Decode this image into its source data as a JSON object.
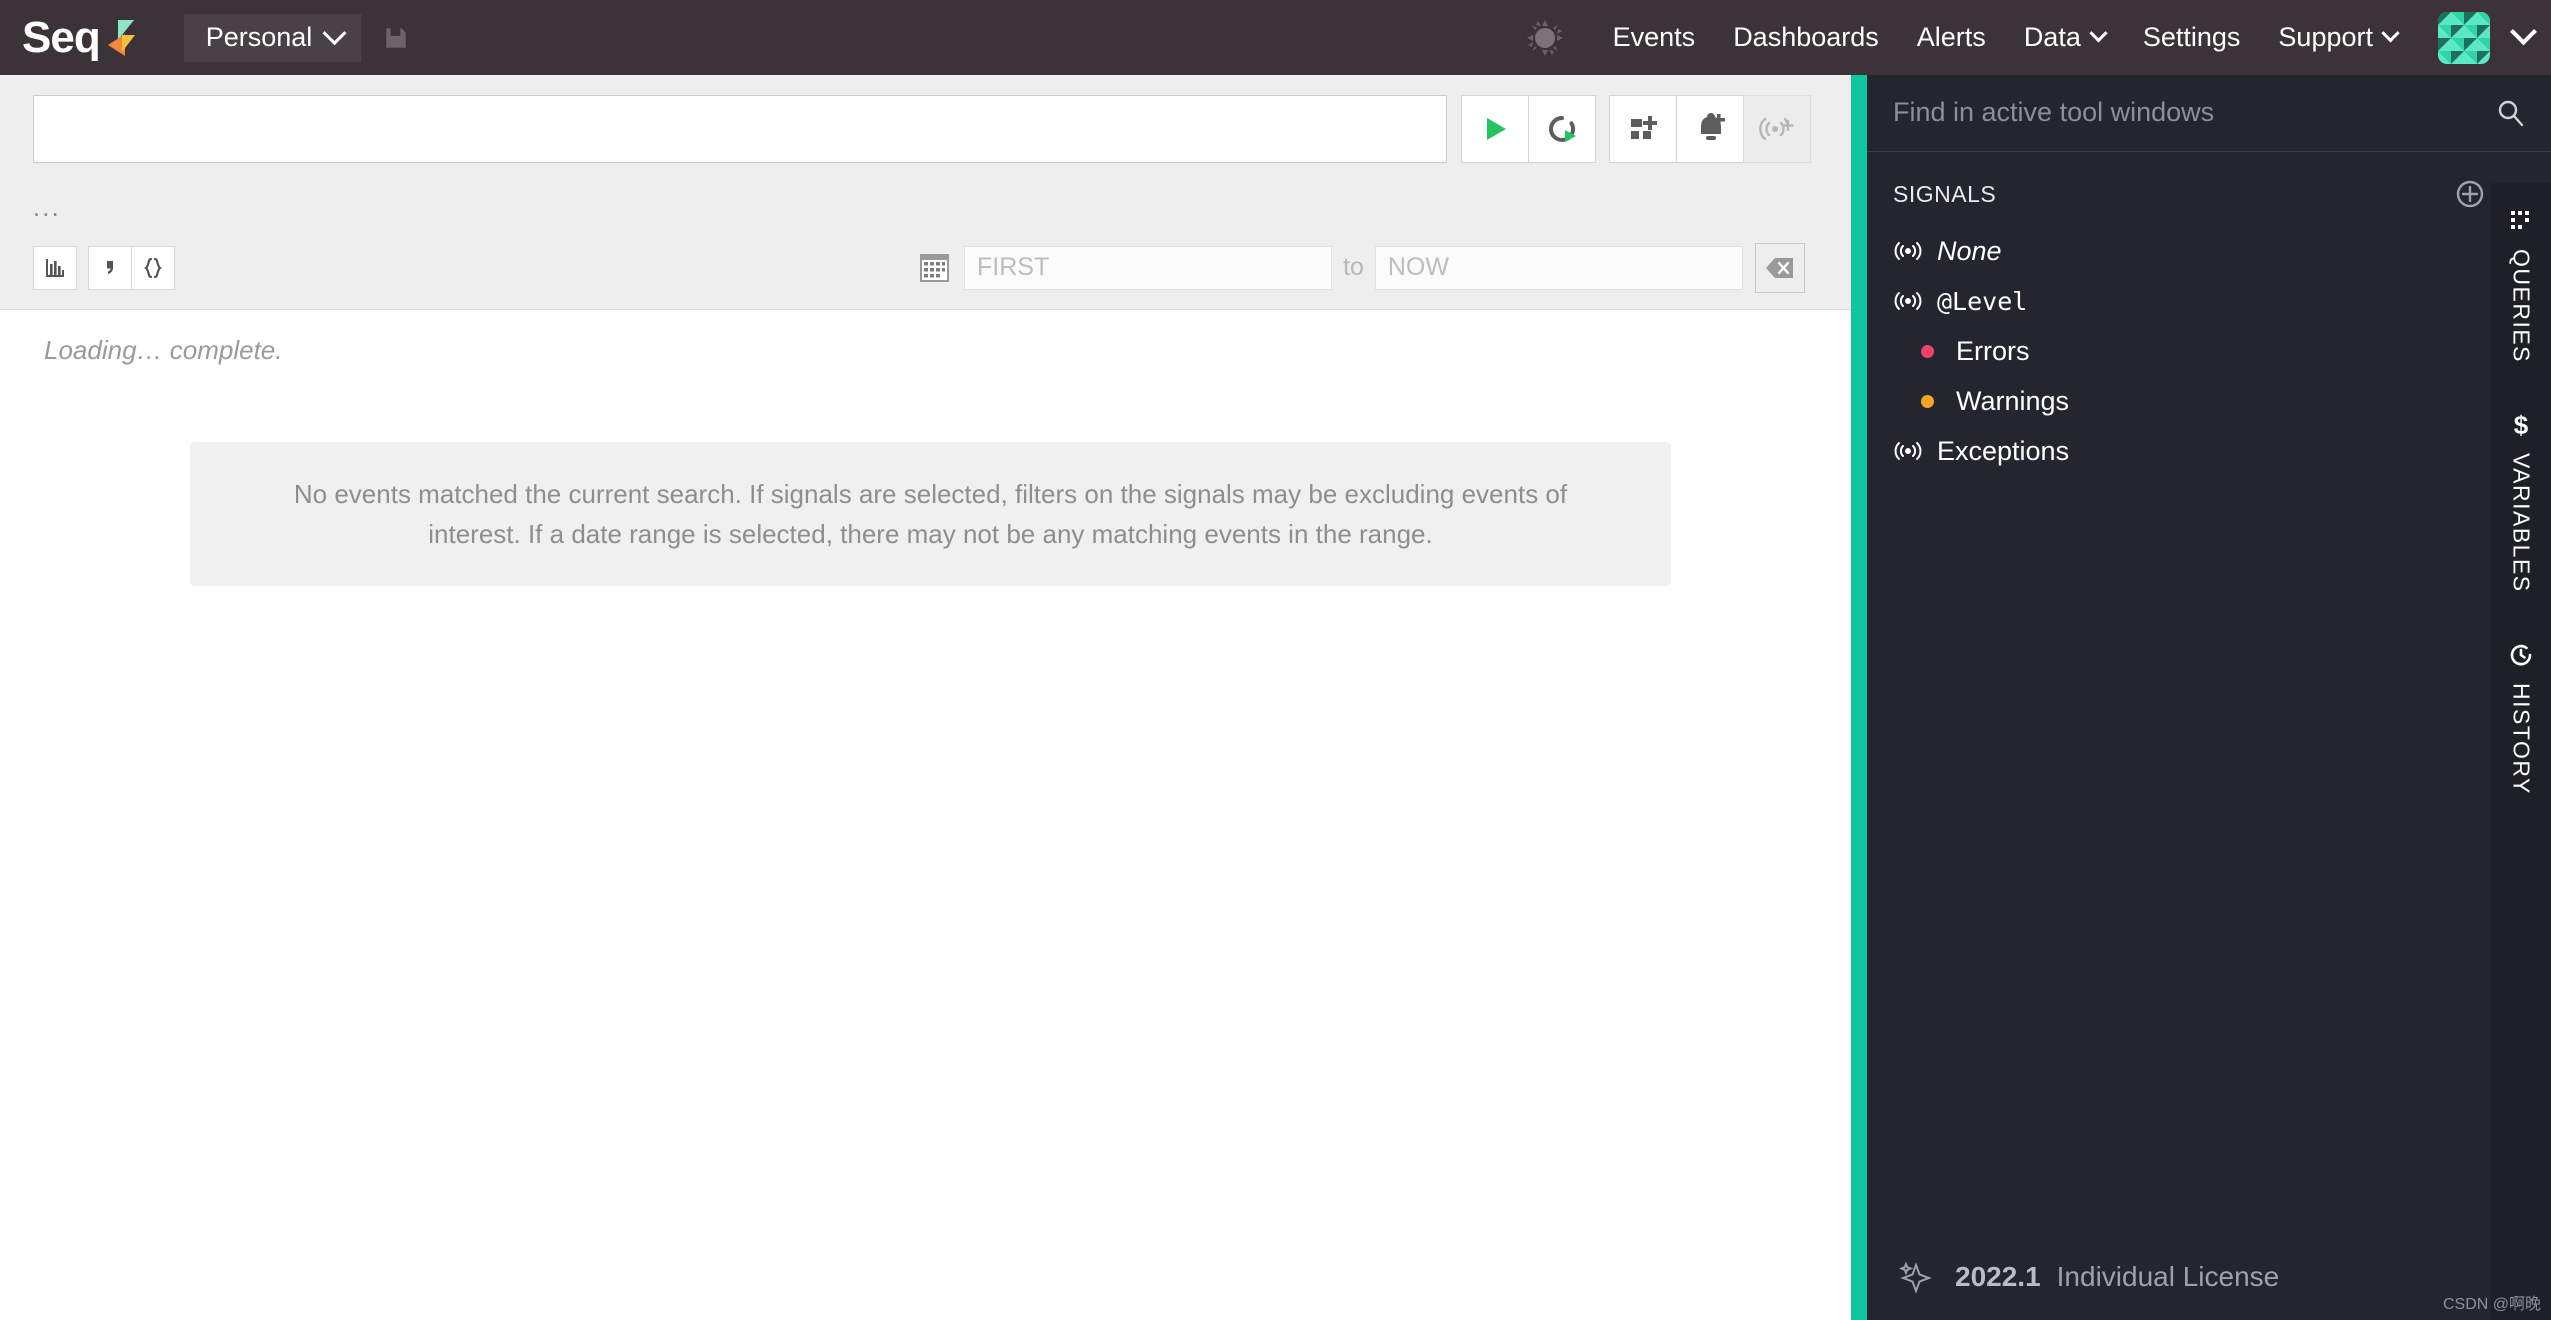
{
  "topnav": {
    "brand": "Seq",
    "brand_mark_icon": "seq-logo-mark",
    "scope_label": "Personal",
    "scope_chevron_icon": "chevron-down-icon",
    "save_icon": "save-disk-icon",
    "theme_icon": "brightness-sun-icon",
    "items": [
      {
        "label": "Events",
        "name": "events",
        "has_chevron": false
      },
      {
        "label": "Dashboards",
        "name": "dashboards",
        "has_chevron": false
      },
      {
        "label": "Alerts",
        "name": "alerts",
        "has_chevron": false
      },
      {
        "label": "Data",
        "name": "data",
        "has_chevron": true
      },
      {
        "label": "Settings",
        "name": "settings",
        "has_chevron": false
      },
      {
        "label": "Support",
        "name": "support",
        "has_chevron": true
      }
    ],
    "avatar_icon": "user-avatar-identicon",
    "avatar_chevron_icon": "chevron-down-icon"
  },
  "query": {
    "input_value": "",
    "input_placeholder": "",
    "buttons": [
      {
        "name": "run-query-button",
        "icon": "play-icon",
        "disabled": false
      },
      {
        "name": "auto-refresh-button",
        "icon": "auto-refresh-icon",
        "disabled": false
      },
      {
        "name": "add-to-dashboard-button",
        "icon": "add-chart-icon",
        "disabled": false
      },
      {
        "name": "create-alert-button",
        "icon": "bell-plus-icon",
        "disabled": false
      },
      {
        "name": "create-signal-button",
        "icon": "signal-plus-icon",
        "disabled": true
      }
    ],
    "ellipsis": "..."
  },
  "toolbar2": {
    "view_buttons": [
      {
        "name": "chart-view-button",
        "icon": "bar-chart-icon"
      },
      {
        "name": "csv-export-button",
        "icon": "comma-csv-icon"
      },
      {
        "name": "json-export-button",
        "icon": "curly-braces-json-icon"
      }
    ],
    "calendar_icon": "calendar-icon",
    "from_value": "",
    "from_placeholder": "FIRST",
    "to_label": "to",
    "to_value": "",
    "to_placeholder": "NOW",
    "clear_icon": "clear-backspace-icon"
  },
  "results": {
    "loading_text": "Loading… complete.",
    "empty_message": "No events matched the current search. If signals are selected, filters on the signals may be excluding events of interest. If a date range is selected, there may not be any matching events in the range."
  },
  "rightpanel": {
    "find_placeholder": "Find in active tool windows",
    "find_value": "",
    "search_icon": "search-icon",
    "section_title": "SIGNALS",
    "add_icon": "plus-circle-icon",
    "expand_icon": "chevron-right-icon",
    "signals": [
      {
        "label": "None",
        "style": "italic",
        "icon": "signal-icon",
        "indent": false,
        "dot_color": null,
        "collapse_icon": null
      },
      {
        "label": "@Level",
        "style": "mono",
        "icon": "signal-icon",
        "indent": false,
        "dot_color": null,
        "collapse_icon": "chevron-up-icon"
      },
      {
        "label": "Errors",
        "style": "plain",
        "icon": null,
        "indent": true,
        "dot_color": "#f0426a",
        "collapse_icon": null
      },
      {
        "label": "Warnings",
        "style": "plain",
        "icon": null,
        "indent": true,
        "dot_color": "#f5a623",
        "collapse_icon": null
      },
      {
        "label": "Exceptions",
        "style": "plain",
        "icon": "signal-icon",
        "indent": false,
        "dot_color": null,
        "collapse_icon": null
      }
    ],
    "rail_tabs": [
      {
        "label": "QUERIES",
        "icon": "queries-dots-icon"
      },
      {
        "label": "VARIABLES",
        "icon": "dollar-variables-icon"
      },
      {
        "label": "HISTORY",
        "icon": "history-clock-icon"
      }
    ],
    "footer": {
      "spark_icon": "sparkle-icon",
      "version": "2022.1",
      "license": "Individual License"
    }
  },
  "watermark": "CSDN @啊晚",
  "colors": {
    "topnav_bg": "#3b3338",
    "accent_teal": "#0fc6a2",
    "panel_bg": "#24262f",
    "rail_bg": "#1e2028",
    "toolbar_bg": "#efeeee",
    "error_dot": "#f0426a",
    "warning_dot": "#f5a623",
    "play_green": "#22c55e"
  }
}
